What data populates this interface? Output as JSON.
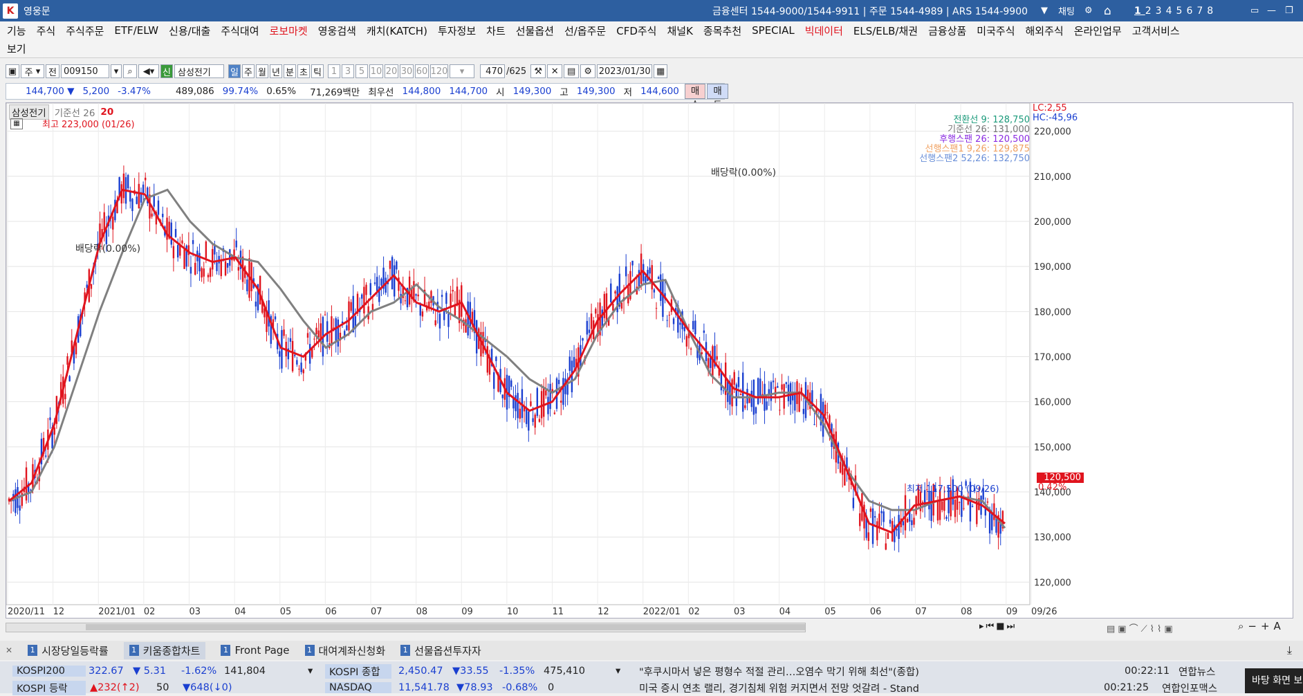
{
  "window": {
    "title": "영웅문",
    "contacts": "금융센터 1544-9000/1544-9911 | 주문 1544-4989 | ARS 1544-9900",
    "chat_label": "채팅",
    "screen_numbers": [
      "1",
      "2",
      "3",
      "4",
      "5",
      "6",
      "7",
      "8"
    ]
  },
  "menu": {
    "row1": [
      {
        "label": "기능"
      },
      {
        "label": "주식"
      },
      {
        "label": "주식주문"
      },
      {
        "label": "ETF/ELW"
      },
      {
        "label": "신용/대출"
      },
      {
        "label": "주식대여"
      },
      {
        "label": "로보마켓",
        "accent": "#e0141e"
      },
      {
        "label": "영웅검색"
      },
      {
        "label": "캐치(KATCH)"
      },
      {
        "label": "투자정보"
      },
      {
        "label": "차트"
      },
      {
        "label": "선물옵션"
      },
      {
        "label": "선/옵주문"
      },
      {
        "label": "CFD주식"
      },
      {
        "label": "채널K"
      },
      {
        "label": "종목추천"
      },
      {
        "label": "SPECIAL"
      },
      {
        "label": "빅데이터",
        "accent": "#e0141e"
      },
      {
        "label": "ELS/ELB/채권"
      },
      {
        "label": "금융상품"
      },
      {
        "label": "미국주식"
      },
      {
        "label": "해외주식"
      },
      {
        "label": "온라인업무"
      },
      {
        "label": "고객서비스"
      }
    ],
    "row2": [
      {
        "label": "보기"
      }
    ]
  },
  "toolbar": {
    "market": "주",
    "prefix": "전",
    "code": "009150",
    "credit_badge": "신",
    "stock_name": "삼성전기",
    "periods": [
      "일",
      "주",
      "월",
      "년",
      "분",
      "초",
      "틱"
    ],
    "active_period": "일",
    "intervals": [
      "1",
      "3",
      "5",
      "10",
      "20",
      "30",
      "60",
      "120"
    ],
    "count_current": "470",
    "count_total": "/625",
    "date": "2023/01/30"
  },
  "quote": {
    "price": "144,700",
    "direction": "▼",
    "change": "5,200",
    "change_pct": "-3.47%",
    "volume": "489,086",
    "volume_ratio": "99.74%",
    "turnover": "0.65%",
    "amount": "71,269백만",
    "best_label": "최우선",
    "ask": "144,800",
    "bid": "144,700",
    "open_label": "시",
    "open": "149,300",
    "high_label": "고",
    "high": "149,300",
    "low_label": "저",
    "low": "144,600",
    "buy_label": "매수",
    "sell_label": "매도"
  },
  "chart_legend": {
    "name": "삼성전기",
    "base_label": "기준선 26",
    "count": "20",
    "high_note": "최고 223,000 (01/26)",
    "low_note": "최저 117,500 (09/26)",
    "dividend1": "배당락(0.00%)",
    "dividend2": "배당락(0.00%)",
    "lc": "LC:2,55",
    "hc": "HC:-45,96",
    "ichimoku": [
      {
        "label": "전환선 9: 128,750",
        "color": "#1a9a7a"
      },
      {
        "label": "기준선 26: 131,000",
        "color": "#777777"
      },
      {
        "label": "후행스팬 26: 120,500",
        "color": "#8a2be2"
      },
      {
        "label": "선행스팬1 9,26: 129,875",
        "color": "#f0a060"
      },
      {
        "label": "선행스팬2 52,26: 132,750",
        "color": "#6a8fd8"
      }
    ],
    "last_price_tag": "120,500",
    "last_change_tag": "0.42%"
  },
  "chart_data": {
    "type": "line",
    "title": "삼성전기",
    "ylim": [
      115000,
      225000
    ],
    "y_ticks": [
      "220,000",
      "210,000",
      "200,000",
      "190,000",
      "180,000",
      "170,000",
      "160,000",
      "150,000",
      "140,000",
      "130,000",
      "120,000"
    ],
    "x_ticks": [
      "2020/11",
      "12",
      "2021/01",
      "02",
      "03",
      "04",
      "05",
      "06",
      "07",
      "08",
      "09",
      "10",
      "11",
      "12",
      "2022/01",
      "02",
      "03",
      "04",
      "05",
      "06",
      "07",
      "08",
      "09",
      "09/26"
    ],
    "colors": {
      "up": "#e0141e",
      "down": "#1a3fd0",
      "base_line": "#808080",
      "conversion_line": "#e0141e"
    },
    "series": [
      {
        "name": "기준선 26",
        "values": [
          138000,
          140000,
          150000,
          165000,
          180000,
          193000,
          205000,
          207000,
          200000,
          195000,
          192000,
          191000,
          185000,
          178000,
          172000,
          175000,
          180000,
          182000,
          186000,
          181000,
          178000,
          174000,
          170000,
          165000,
          162000,
          165000,
          175000,
          182000,
          186000,
          187000,
          176000,
          166000,
          161000,
          161000,
          162000,
          162000,
          155000,
          145000,
          138000,
          136000,
          136000,
          138000,
          139000,
          138000,
          132000
        ]
      },
      {
        "name": "전환선 9",
        "values": [
          138000,
          142000,
          155000,
          175000,
          195000,
          207000,
          206000,
          197000,
          193000,
          191000,
          192000,
          185000,
          172000,
          170000,
          175000,
          178000,
          183000,
          188000,
          182000,
          180000,
          182000,
          172000,
          162000,
          158000,
          160000,
          167000,
          178000,
          184000,
          189000,
          183000,
          176000,
          170000,
          163000,
          161000,
          161000,
          162000,
          157000,
          145000,
          133000,
          131000,
          137000,
          138000,
          139000,
          137000,
          133000
        ]
      }
    ]
  },
  "bottom": {
    "tabs": [
      {
        "num": "1",
        "label": "시장당일등락률",
        "active": false
      },
      {
        "num": "1",
        "label": "키움종합차트",
        "active": true
      },
      {
        "num": "1",
        "label": "Front Page",
        "active": false
      },
      {
        "num": "1",
        "label": "대여계좌신청화",
        "active": false
      },
      {
        "num": "1",
        "label": "선물옵션투자자",
        "active": false
      }
    ],
    "ticker_row1": {
      "idx1_name": "KOSPI200",
      "idx1_val": "322.67",
      "idx1_chg": "▼ 5.31",
      "idx1_pct": "-1.62%",
      "idx1_vol": "141,804",
      "idx2_name": "KOSPI 종합",
      "idx2_val": "2,450.47",
      "idx2_chg": "▼33.55",
      "idx2_pct": "-1.35%",
      "idx2_vol": "475,410",
      "news": "\"후쿠시마서 넣은 평형수 적절 관리…오염수 막기 위해 최선\"(종합)",
      "news_time": "00:22:11",
      "news_src": "연합뉴스"
    },
    "ticker_row2": {
      "idx1_name": "KOSPI 등락",
      "idx1_a": "▲232(↑2)",
      "idx1_b": "50",
      "idx1_c": "▼648(↓0)",
      "idx2_name": "NASDAQ",
      "idx2_val": "11,541.78",
      "idx2_chg": "▼78.93",
      "idx2_pct": "-0.68%",
      "idx2_vol": "0",
      "news": "미국 증시 연초 랠리, 경기침체 위험 커지면서 전망 엇갈려 - Stand",
      "news_time": "00:21:25",
      "news_src": "연합인포맥스"
    },
    "popup": "바탕 화면 보기"
  }
}
